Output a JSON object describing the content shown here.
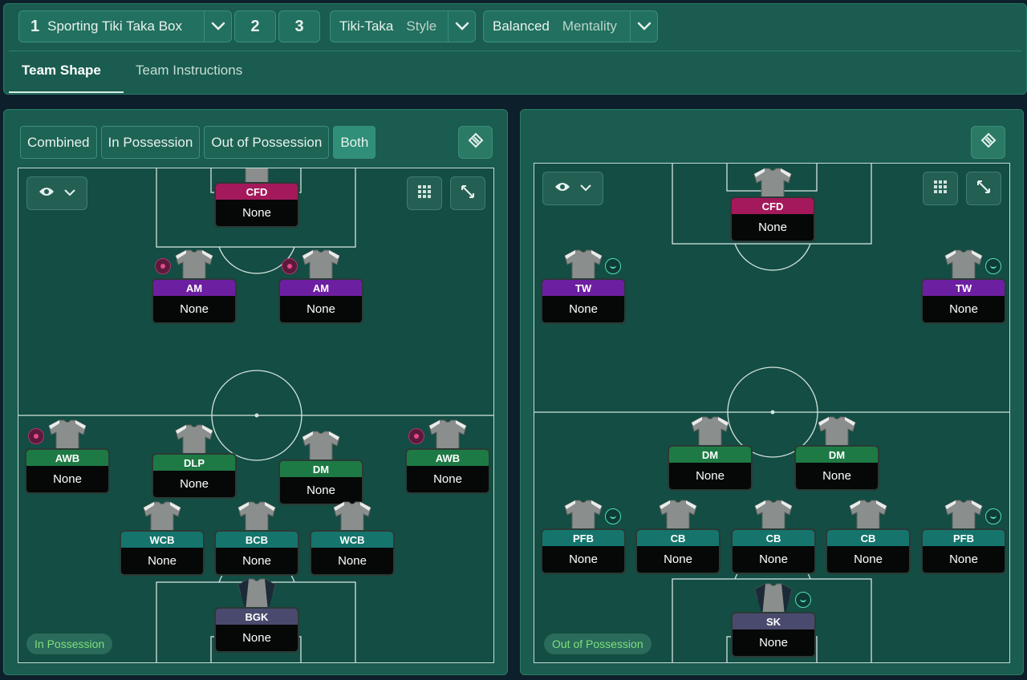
{
  "header": {
    "tactic": {
      "number": "1",
      "name": "Sporting Tiki Taka Box"
    },
    "slots": [
      "2",
      "3"
    ],
    "style": {
      "value": "Tiki-Taka",
      "label": "Style"
    },
    "mentality": {
      "value": "Balanced",
      "label": "Mentality"
    }
  },
  "tabs": [
    {
      "label": "Team Shape",
      "active": true
    },
    {
      "label": "Team Instructions",
      "active": false
    }
  ],
  "left_panel": {
    "toggles": [
      {
        "label": "Combined",
        "active": false
      },
      {
        "label": "In Possession",
        "active": false
      },
      {
        "label": "Out of Possession",
        "active": false
      },
      {
        "label": "Both",
        "active": true
      }
    ],
    "phase_label": "In Possession",
    "players": [
      {
        "role": "CFD",
        "name": "None",
        "duty": ""
      },
      {
        "role": "AM",
        "name": "None",
        "duty": "attack"
      },
      {
        "role": "AM",
        "name": "None",
        "duty": "attack"
      },
      {
        "role": "AWB",
        "name": "None",
        "duty": "attack"
      },
      {
        "role": "DLP",
        "name": "None",
        "duty": ""
      },
      {
        "role": "DM",
        "name": "None",
        "duty": ""
      },
      {
        "role": "AWB",
        "name": "None",
        "duty": "attack"
      },
      {
        "role": "WCB",
        "name": "None",
        "duty": ""
      },
      {
        "role": "BCB",
        "name": "None",
        "duty": ""
      },
      {
        "role": "WCB",
        "name": "None",
        "duty": ""
      },
      {
        "role": "BGK",
        "name": "None",
        "duty": ""
      }
    ]
  },
  "right_panel": {
    "phase_label": "Out of Possession",
    "players": [
      {
        "role": "CFD",
        "name": "None",
        "duty": ""
      },
      {
        "role": "TW",
        "name": "None",
        "duty": "support"
      },
      {
        "role": "TW",
        "name": "None",
        "duty": "support"
      },
      {
        "role": "DM",
        "name": "None",
        "duty": ""
      },
      {
        "role": "DM",
        "name": "None",
        "duty": ""
      },
      {
        "role": "PFB",
        "name": "None",
        "duty": "support"
      },
      {
        "role": "CB",
        "name": "None",
        "duty": ""
      },
      {
        "role": "CB",
        "name": "None",
        "duty": ""
      },
      {
        "role": "CB",
        "name": "None",
        "duty": ""
      },
      {
        "role": "PFB",
        "name": "None",
        "duty": "support"
      },
      {
        "role": "SK",
        "name": "None",
        "duty": "support"
      }
    ]
  },
  "icons": {
    "chevron": "chevron-down-icon",
    "eye": "eye-icon",
    "grid": "grid-icon",
    "expand": "expand-icon",
    "view": "tactics-board-icon",
    "shirt": "shirt-icon"
  },
  "colors": {
    "cfd": "#a3195b",
    "am": "#6d1fa1",
    "midfield": "#1e7a45",
    "defence": "#15756d",
    "goalkeeper": "#4a4a6e",
    "phase_text": "#7de07a"
  }
}
